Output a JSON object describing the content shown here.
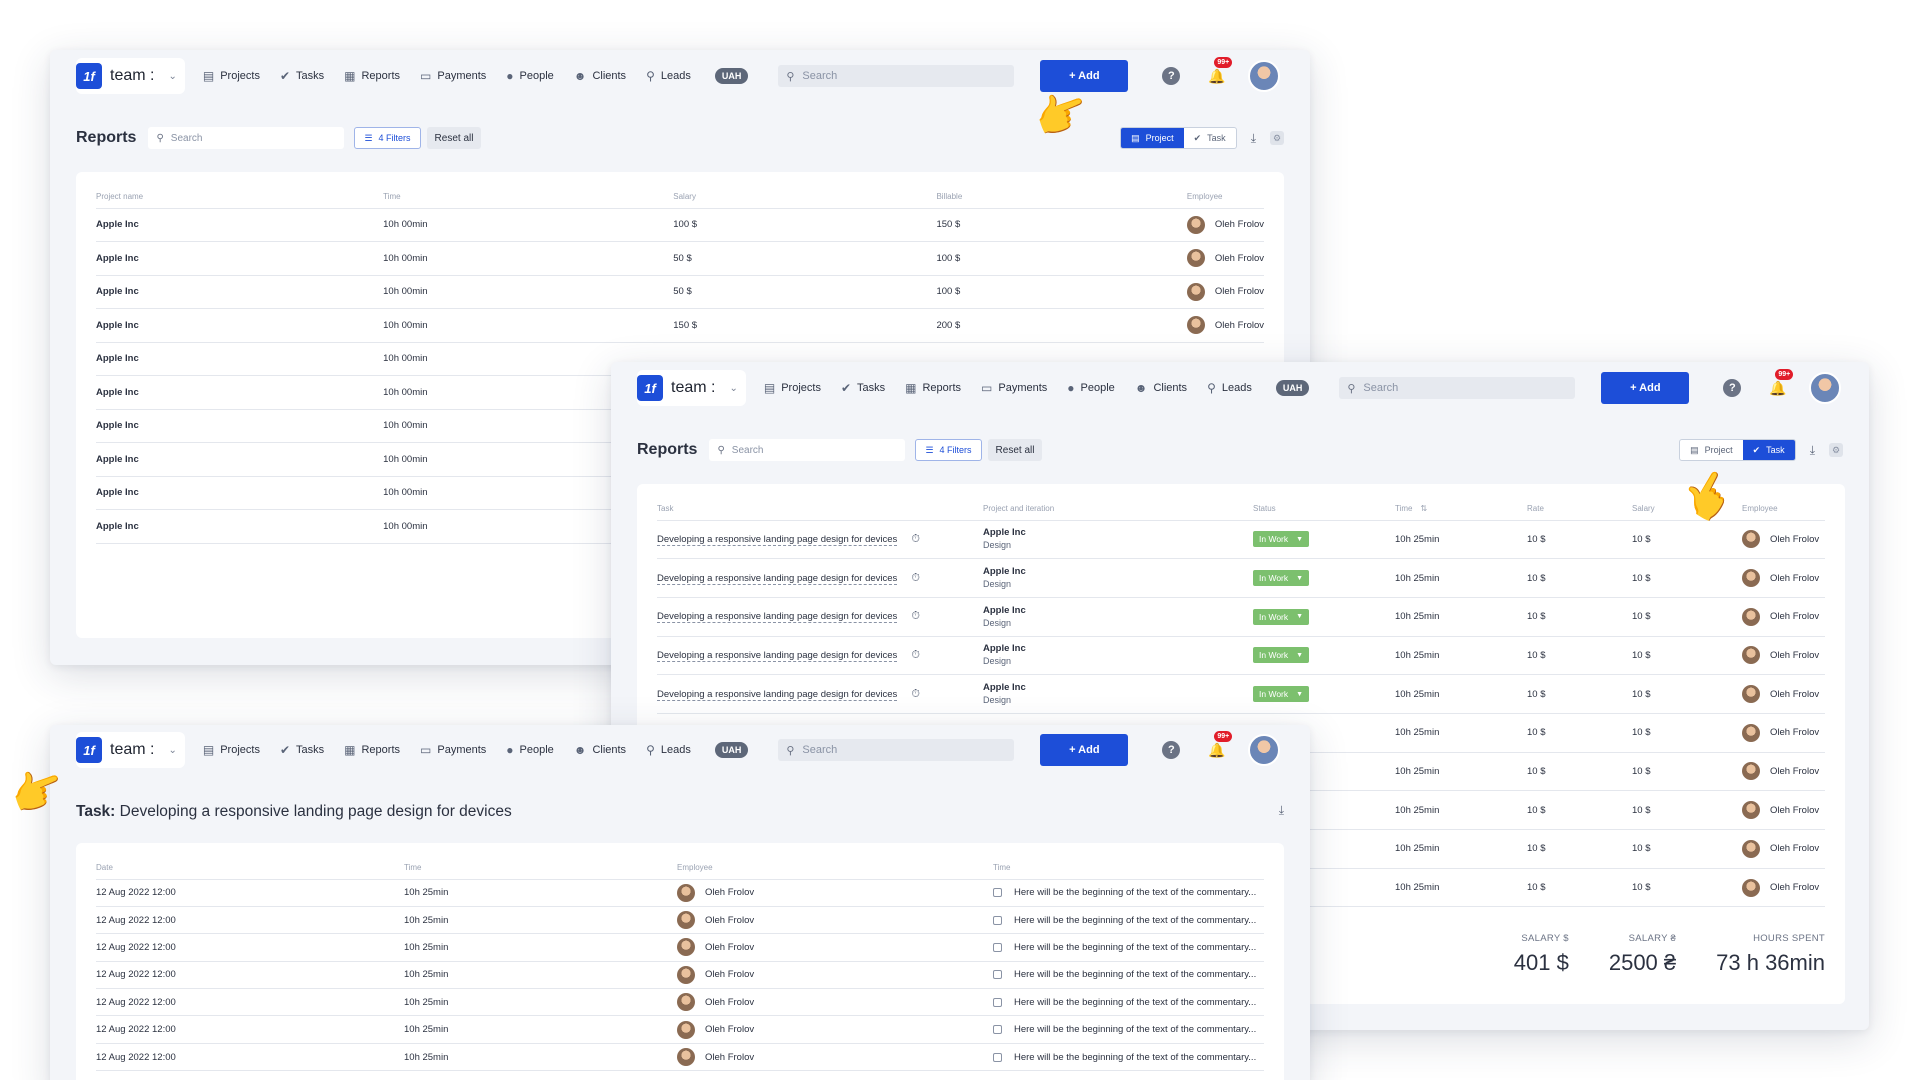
{
  "nav": {
    "brand": "team :",
    "logo_text": "1f",
    "items": [
      {
        "label": "Projects",
        "icon": "▤"
      },
      {
        "label": "Tasks",
        "icon": "✔"
      },
      {
        "label": "Reports",
        "icon": "▦"
      },
      {
        "label": "Payments",
        "icon": "▭"
      },
      {
        "label": "People",
        "icon": "●"
      },
      {
        "label": "Clients",
        "icon": "☻"
      },
      {
        "label": "Leads",
        "icon": "⚲"
      }
    ],
    "currency": "UAH",
    "search_placeholder": "Search",
    "add_label": "+ Add",
    "notifications_badge": "99+"
  },
  "reports": {
    "title": "Reports",
    "search_placeholder": "Search",
    "filters_label": "4 Filters",
    "reset_label": "Reset all",
    "view_project": "Project",
    "view_task": "Task"
  },
  "project_table": {
    "columns": [
      "Project name",
      "Time",
      "Salary",
      "Billable",
      "Employee"
    ],
    "rows": [
      {
        "project": "Apple Inc",
        "time": "10h 00min",
        "salary": "100 $",
        "billable": "150 $",
        "employee": "Oleh Frolov"
      },
      {
        "project": "Apple Inc",
        "time": "10h 00min",
        "salary": "50 $",
        "billable": "100 $",
        "employee": "Oleh Frolov"
      },
      {
        "project": "Apple Inc",
        "time": "10h 00min",
        "salary": "50 $",
        "billable": "100 $",
        "employee": "Oleh Frolov"
      },
      {
        "project": "Apple Inc",
        "time": "10h 00min",
        "salary": "150 $",
        "billable": "200 $",
        "employee": "Oleh Frolov"
      },
      {
        "project": "Apple Inc",
        "time": "10h 00min",
        "salary": "",
        "billable": "",
        "employee": ""
      },
      {
        "project": "Apple Inc",
        "time": "10h 00min",
        "salary": "",
        "billable": "",
        "employee": ""
      },
      {
        "project": "Apple Inc",
        "time": "10h 00min",
        "salary": "",
        "billable": "",
        "employee": ""
      },
      {
        "project": "Apple Inc",
        "time": "10h 00min",
        "salary": "",
        "billable": "",
        "employee": ""
      },
      {
        "project": "Apple Inc",
        "time": "10h 00min",
        "salary": "",
        "billable": "",
        "employee": ""
      },
      {
        "project": "Apple Inc",
        "time": "10h 00min",
        "salary": "",
        "billable": "",
        "employee": ""
      }
    ]
  },
  "task_table": {
    "columns": [
      "Task",
      "Project and iteration",
      "Status",
      "Time",
      "Rate",
      "Salary",
      "Employee"
    ],
    "rows": [
      {
        "task": "Developing a responsive landing page design for devices",
        "project": "Apple Inc",
        "iteration": "Design",
        "status": "In Work",
        "time": "10h 25min",
        "rate": "10 $",
        "salary": "10 $",
        "employee": "Oleh Frolov"
      },
      {
        "task": "Developing a responsive landing page design for devices",
        "project": "Apple Inc",
        "iteration": "Design",
        "status": "In Work",
        "time": "10h 25min",
        "rate": "10 $",
        "salary": "10 $",
        "employee": "Oleh Frolov"
      },
      {
        "task": "Developing a responsive landing page design for devices",
        "project": "Apple Inc",
        "iteration": "Design",
        "status": "In Work",
        "time": "10h 25min",
        "rate": "10 $",
        "salary": "10 $",
        "employee": "Oleh Frolov"
      },
      {
        "task": "Developing a responsive landing page design for devices",
        "project": "Apple Inc",
        "iteration": "Design",
        "status": "In Work",
        "time": "10h 25min",
        "rate": "10 $",
        "salary": "10 $",
        "employee": "Oleh Frolov"
      },
      {
        "task": "Developing a responsive landing page design for devices",
        "project": "Apple Inc",
        "iteration": "Design",
        "status": "In Work",
        "time": "10h 25min",
        "rate": "10 $",
        "salary": "10 $",
        "employee": "Oleh Frolov"
      },
      {
        "task": "",
        "project": "",
        "iteration": "",
        "status": "",
        "time": "10h 25min",
        "rate": "10 $",
        "salary": "10 $",
        "employee": "Oleh Frolov"
      },
      {
        "task": "",
        "project": "",
        "iteration": "",
        "status": "",
        "time": "10h 25min",
        "rate": "10 $",
        "salary": "10 $",
        "employee": "Oleh Frolov"
      },
      {
        "task": "",
        "project": "",
        "iteration": "",
        "status": "",
        "time": "10h 25min",
        "rate": "10 $",
        "salary": "10 $",
        "employee": "Oleh Frolov"
      },
      {
        "task": "",
        "project": "",
        "iteration": "",
        "status": "",
        "time": "10h 25min",
        "rate": "10 $",
        "salary": "10 $",
        "employee": "Oleh Frolov"
      },
      {
        "task": "",
        "project": "",
        "iteration": "",
        "status": "",
        "time": "10h 25min",
        "rate": "10 $",
        "salary": "10 $",
        "employee": "Oleh Frolov"
      }
    ],
    "totals": [
      {
        "label": "SALARY $",
        "value": "401 $"
      },
      {
        "label": "SALARY ₴",
        "value": "2500 ₴"
      },
      {
        "label": "HOURS SPENT",
        "value": "73 h 36min"
      }
    ]
  },
  "task_detail": {
    "title_prefix": "Task:",
    "title": "Developing a responsive landing page design for devices",
    "columns": [
      "Date",
      "Time",
      "Employee",
      "Time"
    ],
    "rows": [
      {
        "date": "12 Aug 2022 12:00",
        "time": "10h 25min",
        "employee": "Oleh Frolov",
        "comment": "Here will be the beginning of the text of the commentary..."
      },
      {
        "date": "12 Aug 2022 12:00",
        "time": "10h 25min",
        "employee": "Oleh Frolov",
        "comment": "Here will be the beginning of the text of the commentary..."
      },
      {
        "date": "12 Aug 2022 12:00",
        "time": "10h 25min",
        "employee": "Oleh Frolov",
        "comment": "Here will be the beginning of the text of the commentary..."
      },
      {
        "date": "12 Aug 2022 12:00",
        "time": "10h 25min",
        "employee": "Oleh Frolov",
        "comment": "Here will be the beginning of the text of the commentary..."
      },
      {
        "date": "12 Aug 2022 12:00",
        "time": "10h 25min",
        "employee": "Oleh Frolov",
        "comment": "Here will be the beginning of the text of the commentary..."
      },
      {
        "date": "12 Aug 2022 12:00",
        "time": "10h 25min",
        "employee": "Oleh Frolov",
        "comment": "Here will be the beginning of the text of the commentary..."
      },
      {
        "date": "12 Aug 2022 12:00",
        "time": "10h 25min",
        "employee": "Oleh Frolov",
        "comment": "Here will be the beginning of the text of the commentary..."
      }
    ]
  },
  "colors": {
    "accent": "#1d4ed8",
    "status_in_work": "#7cc06e",
    "badge": "#e11d2a"
  }
}
